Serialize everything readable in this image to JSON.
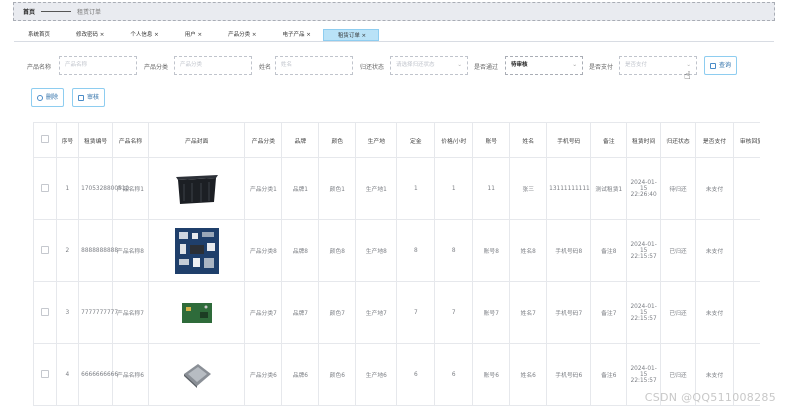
{
  "breadcrumb": {
    "home": "首页",
    "current": "租赁订单"
  },
  "tabs": [
    {
      "label": "系统首页",
      "active": false
    },
    {
      "label": "修改密码 ×",
      "active": false
    },
    {
      "label": "个人信息 ×",
      "active": false
    },
    {
      "label": "用户 ×",
      "active": false
    },
    {
      "label": "产品分类 ×",
      "active": false
    },
    {
      "label": "电子产品 ×",
      "active": false
    },
    {
      "label": "租赁订单 ×",
      "active": true
    }
  ],
  "filters": {
    "product_name_label": "产品名称",
    "product_name_ph": "产品名称",
    "category_label": "产品分类",
    "category_ph": "产品分类",
    "name_label": "姓名",
    "name_ph": "姓名",
    "return_label": "归还状态",
    "return_ph": "请选择归还状态",
    "pass_label": "是否通过",
    "pass_value": "待审核",
    "pay_label": "是否支付",
    "pay_ph": "是否支付",
    "search_button": "查询"
  },
  "actions": {
    "delete": "删除",
    "review": "审核"
  },
  "table": {
    "headers": [
      "序号",
      "租赁编号",
      "产品名称",
      "产品封面",
      "产品分类",
      "品牌",
      "颜色",
      "生产地",
      "定金",
      "价格/小时",
      "账号",
      "姓名",
      "手机号码",
      "备注",
      "租赁时间",
      "归还状态",
      "是否支付",
      "审核回复"
    ],
    "rows": [
      {
        "index": "1",
        "order_no": "1705328800510",
        "product": "产品名称1",
        "image": "bin",
        "category": "产品分类1",
        "brand": "品牌1",
        "color": "颜色1",
        "origin": "生产地1",
        "deposit": "1",
        "price": "1",
        "account": "11",
        "name": "张三",
        "phone": "13111111111",
        "remark": "测试租赁1",
        "time": "2024-01-15 22:26:40",
        "return": "待归还",
        "paid": "未支付"
      },
      {
        "index": "2",
        "order_no": "8888888888",
        "product": "产品名称8",
        "image": "board",
        "category": "产品分类8",
        "brand": "品牌8",
        "color": "颜色8",
        "origin": "生产地8",
        "deposit": "8",
        "price": "8",
        "account": "账号8",
        "name": "姓名8",
        "phone": "手机号码8",
        "remark": "备注8",
        "time": "2024-01-15 22:15:57",
        "return": "已归还",
        "paid": "未支付"
      },
      {
        "index": "3",
        "order_no": "7777777777",
        "product": "产品名称7",
        "image": "pcb",
        "category": "产品分类7",
        "brand": "品牌7",
        "color": "颜色7",
        "origin": "生产地7",
        "deposit": "7",
        "price": "7",
        "account": "账号7",
        "name": "姓名7",
        "phone": "手机号码7",
        "remark": "备注7",
        "time": "2024-01-15 22:15:57",
        "return": "已归还",
        "paid": "未支付"
      },
      {
        "index": "4",
        "order_no": "6666666666",
        "product": "产品名称6",
        "image": "chip",
        "category": "产品分类6",
        "brand": "品牌6",
        "color": "颜色6",
        "origin": "生产地6",
        "deposit": "6",
        "price": "6",
        "account": "账号6",
        "name": "姓名6",
        "phone": "手机号码6",
        "remark": "备注6",
        "time": "2024-01-15 22:15:57",
        "return": "已归还",
        "paid": "未支付"
      }
    ]
  },
  "watermark": "CSDN @QQ511008285"
}
